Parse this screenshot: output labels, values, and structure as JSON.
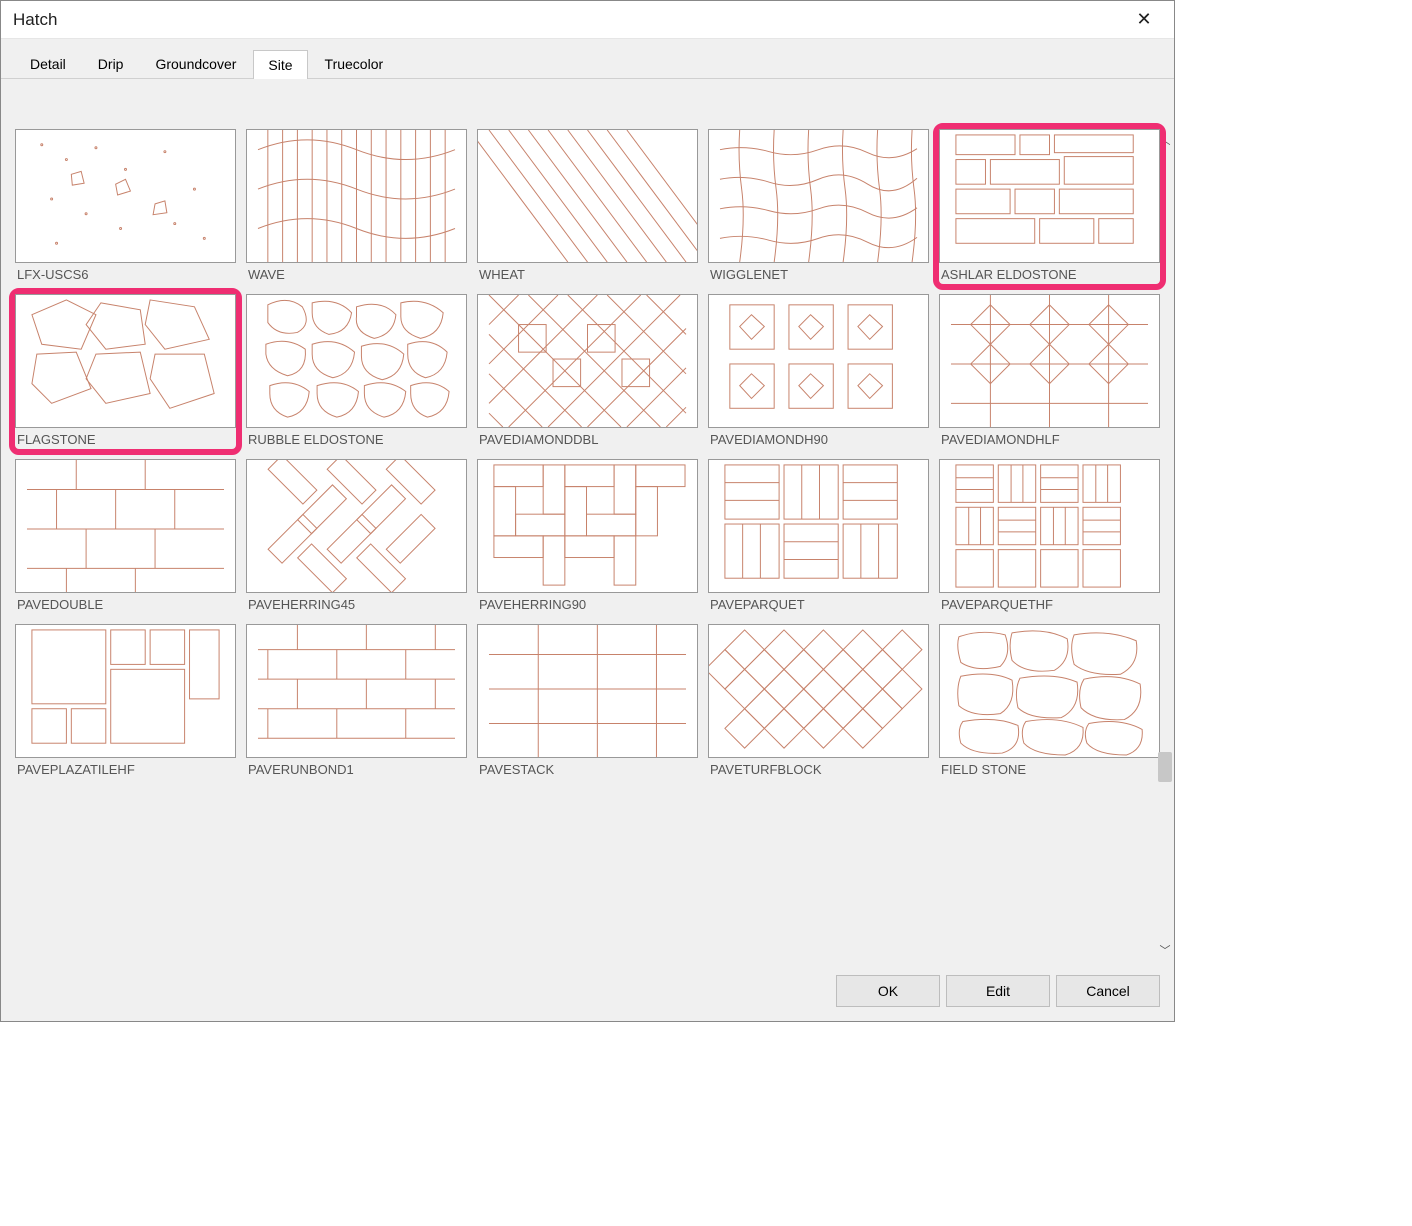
{
  "dialog": {
    "title": "Hatch"
  },
  "tabs": [
    {
      "label": "Detail",
      "active": false
    },
    {
      "label": "Drip",
      "active": false
    },
    {
      "label": "Groundcover",
      "active": false
    },
    {
      "label": "Site",
      "active": true
    },
    {
      "label": "Truecolor",
      "active": false
    }
  ],
  "patterns": [
    {
      "label": "LFX-USCS6",
      "highlighted": false,
      "svg": "uscs6"
    },
    {
      "label": "WAVE",
      "highlighted": false,
      "svg": "wave"
    },
    {
      "label": "WHEAT",
      "highlighted": false,
      "svg": "wheat"
    },
    {
      "label": "WIGGLENET",
      "highlighted": false,
      "svg": "wigglenet"
    },
    {
      "label": "ASHLAR ELDOSTONE",
      "highlighted": true,
      "svg": "ashlar"
    },
    {
      "label": "FLAGSTONE",
      "highlighted": true,
      "svg": "flagstone"
    },
    {
      "label": "RUBBLE ELDOSTONE",
      "highlighted": false,
      "svg": "rubble"
    },
    {
      "label": "PAVEDIAMONDDBL",
      "highlighted": false,
      "svg": "diamonddbl"
    },
    {
      "label": "PAVEDIAMONDH90",
      "highlighted": false,
      "svg": "diamondh90"
    },
    {
      "label": "PAVEDIAMONDHLF",
      "highlighted": false,
      "svg": "diamondhlf"
    },
    {
      "label": "PAVEDOUBLE",
      "highlighted": false,
      "svg": "pavedouble"
    },
    {
      "label": "PAVEHERRING45",
      "highlighted": false,
      "svg": "herring45"
    },
    {
      "label": "PAVEHERRING90",
      "highlighted": false,
      "svg": "herring90"
    },
    {
      "label": "PAVEPARQUET",
      "highlighted": false,
      "svg": "parquet"
    },
    {
      "label": "PAVEPARQUETHF",
      "highlighted": false,
      "svg": "parquethf"
    },
    {
      "label": "PAVEPLAZATILEHF",
      "highlighted": false,
      "svg": "plazatile"
    },
    {
      "label": "PAVERUNBOND1",
      "highlighted": false,
      "svg": "runbond"
    },
    {
      "label": "PAVESTACK",
      "highlighted": false,
      "svg": "pavestack"
    },
    {
      "label": "PAVETURFBLOCK",
      "highlighted": false,
      "svg": "turfblock"
    },
    {
      "label": "FIELD STONE",
      "highlighted": false,
      "svg": "fieldstone"
    }
  ],
  "buttons": {
    "ok": "OK",
    "edit": "Edit",
    "cancel": "Cancel"
  },
  "colors": {
    "highlight": "#ef2e72",
    "stroke": "#c7826b"
  }
}
